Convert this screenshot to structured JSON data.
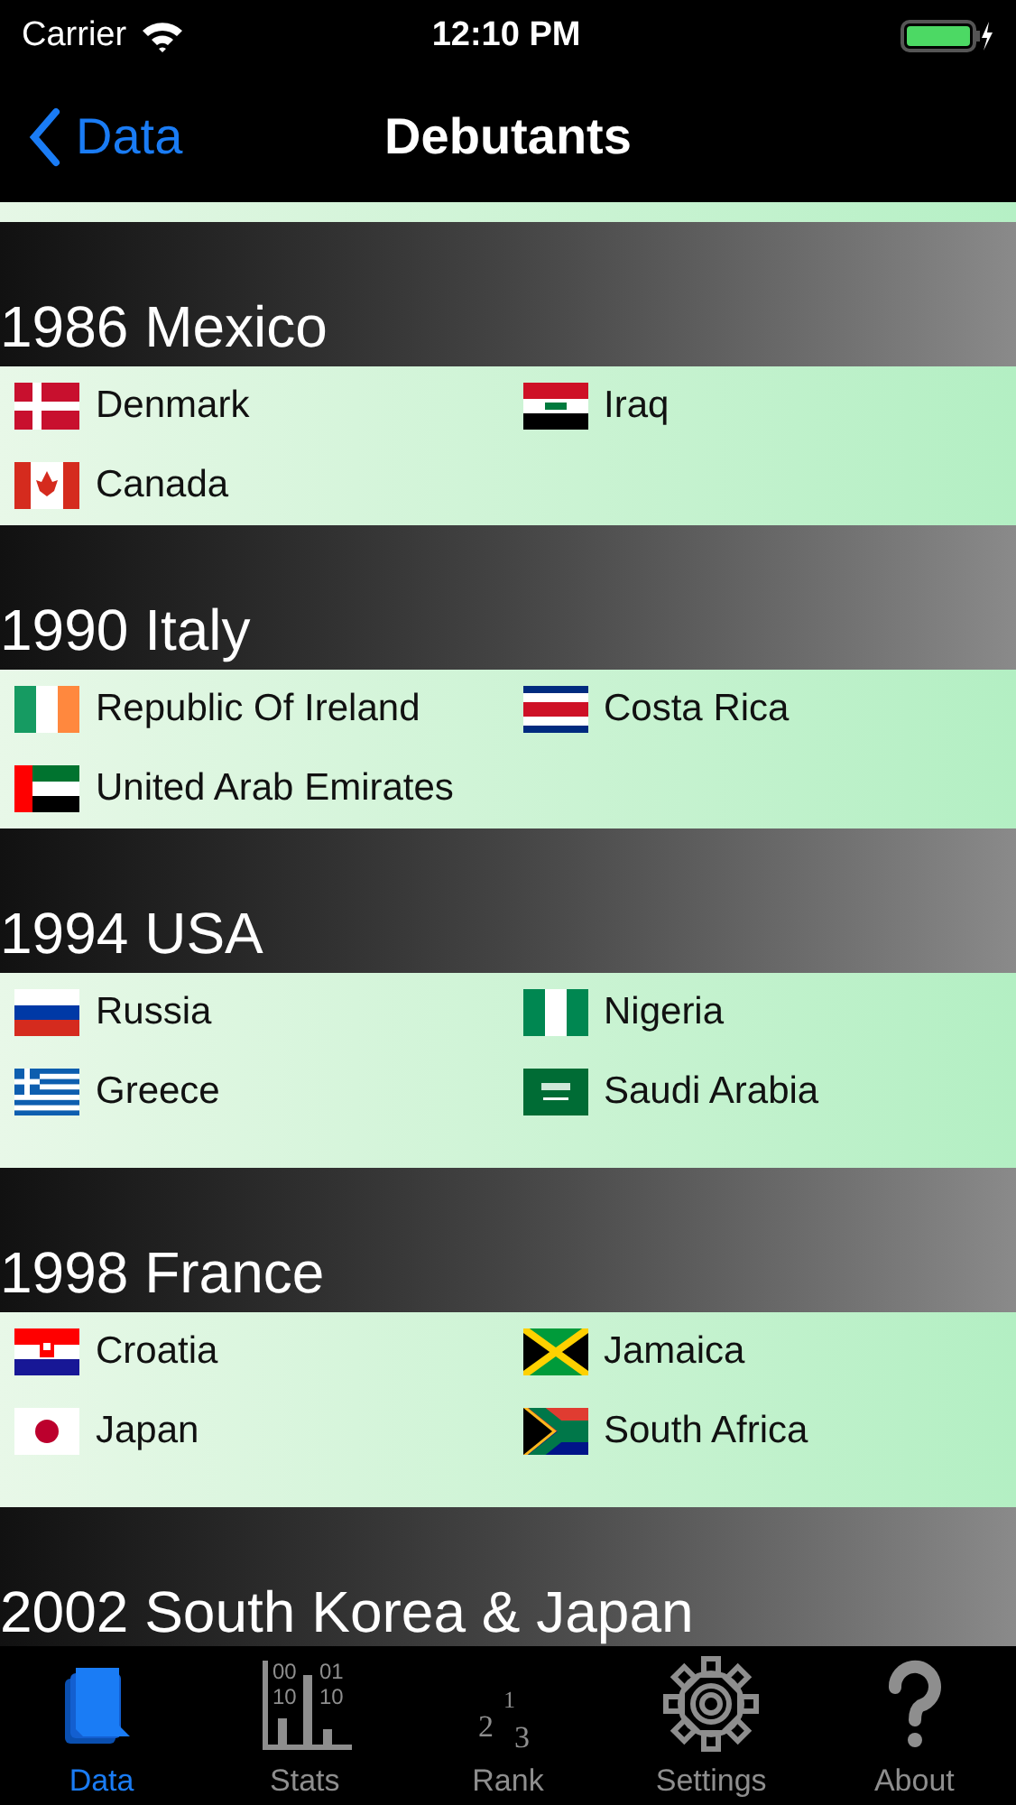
{
  "status_bar": {
    "carrier": "Carrier",
    "time": "12:10 PM"
  },
  "nav": {
    "back": "Data",
    "title": "Debutants"
  },
  "sections": [
    {
      "title": "1986 Mexico",
      "teams": [
        {
          "name": "Denmark",
          "kind": "denmark"
        },
        {
          "name": "Iraq",
          "kind": "iraq"
        },
        {
          "name": "Canada",
          "kind": "canada"
        }
      ]
    },
    {
      "title": "1990 Italy",
      "teams": [
        {
          "name": "Republic Of Ireland",
          "kind": "ireland"
        },
        {
          "name": "Costa Rica",
          "kind": "costarica"
        },
        {
          "name": "United Arab Emirates",
          "kind": "uae"
        }
      ]
    },
    {
      "title": "1994 USA",
      "teams": [
        {
          "name": "Russia",
          "kind": "russia"
        },
        {
          "name": "Nigeria",
          "kind": "nigeria"
        },
        {
          "name": "Greece",
          "kind": "greece"
        },
        {
          "name": "Saudi Arabia",
          "kind": "saudi"
        }
      ]
    },
    {
      "title": "1998 France",
      "teams": [
        {
          "name": "Croatia",
          "kind": "croatia"
        },
        {
          "name": "Jamaica",
          "kind": "jamaica"
        },
        {
          "name": "Japan",
          "kind": "japan"
        },
        {
          "name": "South Africa",
          "kind": "southafrica"
        }
      ]
    },
    {
      "title": "2002 South Korea & Japan"
    }
  ],
  "tabs": [
    {
      "label": "Data",
      "kind": "data",
      "selected": true
    },
    {
      "label": "Stats",
      "kind": "stats",
      "selected": false,
      "icon_labels": [
        "00",
        "01",
        "10",
        "10"
      ]
    },
    {
      "label": "Rank",
      "kind": "rank",
      "selected": false,
      "icon_labels": [
        "2",
        "1",
        "3"
      ]
    },
    {
      "label": "Settings",
      "kind": "settings",
      "selected": false
    },
    {
      "label": "About",
      "kind": "about",
      "selected": false
    }
  ]
}
